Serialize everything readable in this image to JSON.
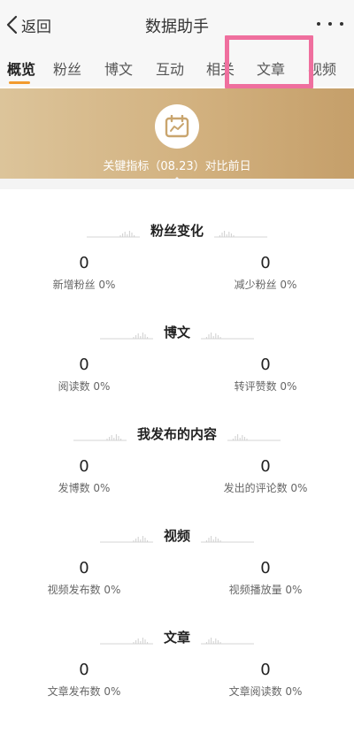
{
  "header": {
    "back_label": "返回",
    "title": "数据助手"
  },
  "tabs": [
    {
      "label": "概览",
      "active": true
    },
    {
      "label": "粉丝",
      "active": false
    },
    {
      "label": "博文",
      "active": false
    },
    {
      "label": "互动",
      "active": false
    },
    {
      "label": "相关",
      "active": false
    },
    {
      "label": "文章",
      "active": false
    },
    {
      "label": "视频",
      "active": false
    }
  ],
  "banner": {
    "text": "关键指标（08.23）对比前日"
  },
  "sections": [
    {
      "title": "粉丝变化",
      "left": {
        "value": "0",
        "label": "新增粉丝 0%"
      },
      "right": {
        "value": "0",
        "label": "减少粉丝 0%"
      }
    },
    {
      "title": "博文",
      "left": {
        "value": "0",
        "label": "阅读数 0%"
      },
      "right": {
        "value": "0",
        "label": "转评赞数 0%"
      }
    },
    {
      "title": "我发布的内容",
      "left": {
        "value": "0",
        "label": "发博数 0%"
      },
      "right": {
        "value": "0",
        "label": "发出的评论数 0%"
      }
    },
    {
      "title": "视频",
      "left": {
        "value": "0",
        "label": "视频发布数 0%"
      },
      "right": {
        "value": "0",
        "label": "视频播放量 0%"
      }
    },
    {
      "title": "文章",
      "left": {
        "value": "0",
        "label": "文章发布数 0%"
      },
      "right": {
        "value": "0",
        "label": "文章阅读数 0%"
      }
    }
  ],
  "colors": {
    "accent": "#f29b2e",
    "highlight": "#ef6f9e",
    "banner": "#d2b17f"
  }
}
